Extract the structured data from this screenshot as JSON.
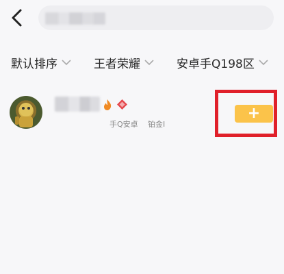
{
  "filters": [
    {
      "label": "默认排序",
      "icon": "chevron-down-icon"
    },
    {
      "label": "王者荣耀",
      "icon": "chevron-down-icon"
    },
    {
      "label": "安卓手Q198区",
      "icon": "chevron-down-icon"
    }
  ],
  "results": [
    {
      "platform": "手Q安卓",
      "rank": "铂金I",
      "icons": [
        "flame-icon",
        "gem-icon"
      ],
      "add_label": "+"
    }
  ],
  "colors": {
    "background": "#f7f7f9",
    "add_button": "#fbc34a",
    "highlight_box": "#e0202a",
    "gem": "#e5484d",
    "flame": "#f08a24"
  }
}
